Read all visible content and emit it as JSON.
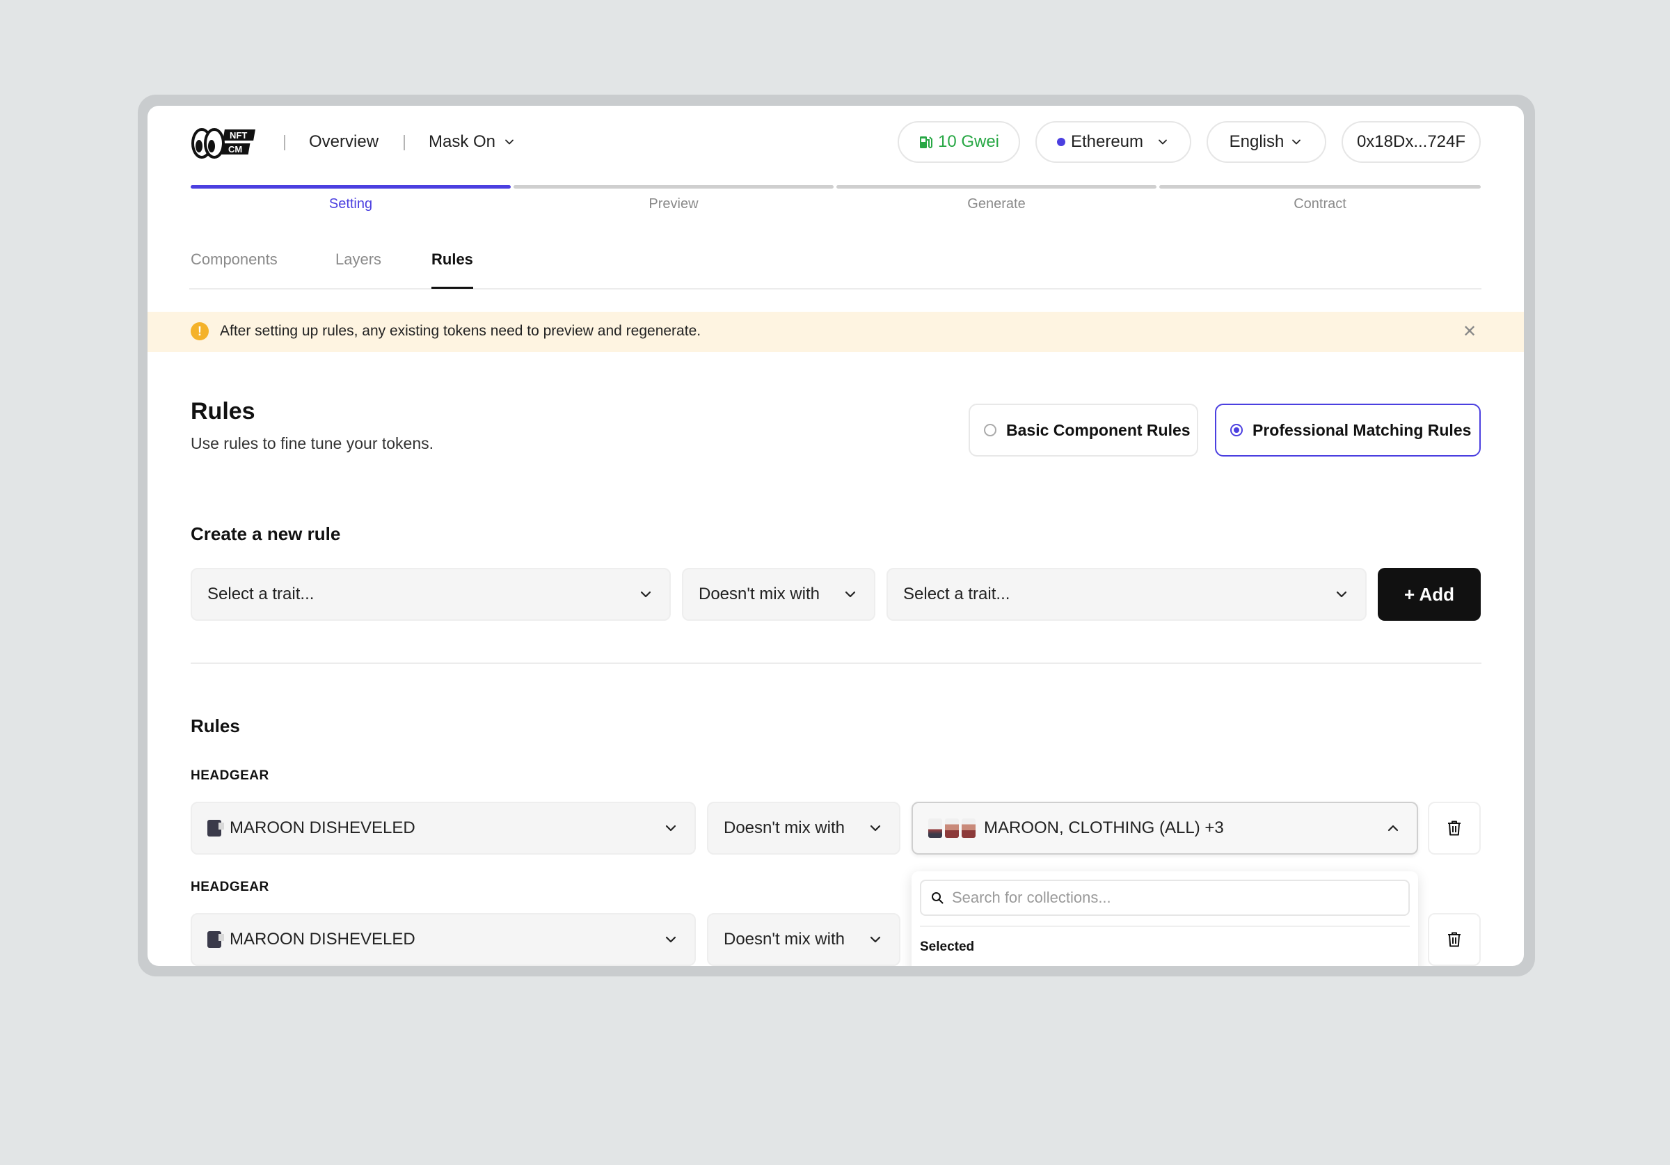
{
  "header": {
    "logo_text": "NFT CM",
    "nav_overview": "Overview",
    "project_name": "Mask On",
    "gas": "10 Gwei",
    "network": "Ethereum",
    "language": "English",
    "wallet": "0x18Dx...724F"
  },
  "steps": [
    {
      "label": "Setting",
      "active": true
    },
    {
      "label": "Preview",
      "active": false
    },
    {
      "label": "Generate",
      "active": false
    },
    {
      "label": "Contract",
      "active": false
    }
  ],
  "tabs": [
    {
      "label": "Components",
      "active": false
    },
    {
      "label": "Layers",
      "active": false
    },
    {
      "label": "Rules",
      "active": true
    }
  ],
  "banner": {
    "text": "After setting up rules,  any existing tokens need to preview and regenerate."
  },
  "rules_section": {
    "title": "Rules",
    "subtitle": "Use rules to fine tune your tokens.",
    "mode_basic": "Basic Component Rules",
    "mode_pro": "Professional Matching Rules",
    "selected_mode": "Professional Matching Rules"
  },
  "create_rule": {
    "title": "Create a new rule",
    "trait_placeholder_left": "Select a trait...",
    "relation": "Doesn't mix with",
    "trait_placeholder_right": "Select a trait...",
    "add_label": "+ Add"
  },
  "rules_list": {
    "title": "Rules",
    "items": [
      {
        "group": "HEADGEAR",
        "trait": "MAROON DISHEVELED",
        "relation": "Doesn't mix with",
        "targets": "MAROON, CLOTHING (ALL) +3"
      },
      {
        "group": "HEADGEAR",
        "trait": "MAROON DISHEVELED",
        "relation": "Doesn't mix with",
        "targets": ""
      }
    ]
  },
  "dropdown": {
    "search_placeholder": "Search for collections...",
    "selected_heading": "Selected"
  },
  "colors": {
    "accent": "#4b3fe0",
    "gas_green": "#28a745",
    "banner_bg": "#fef4e1",
    "warning": "#f4b22a",
    "primary_button": "#111111"
  }
}
